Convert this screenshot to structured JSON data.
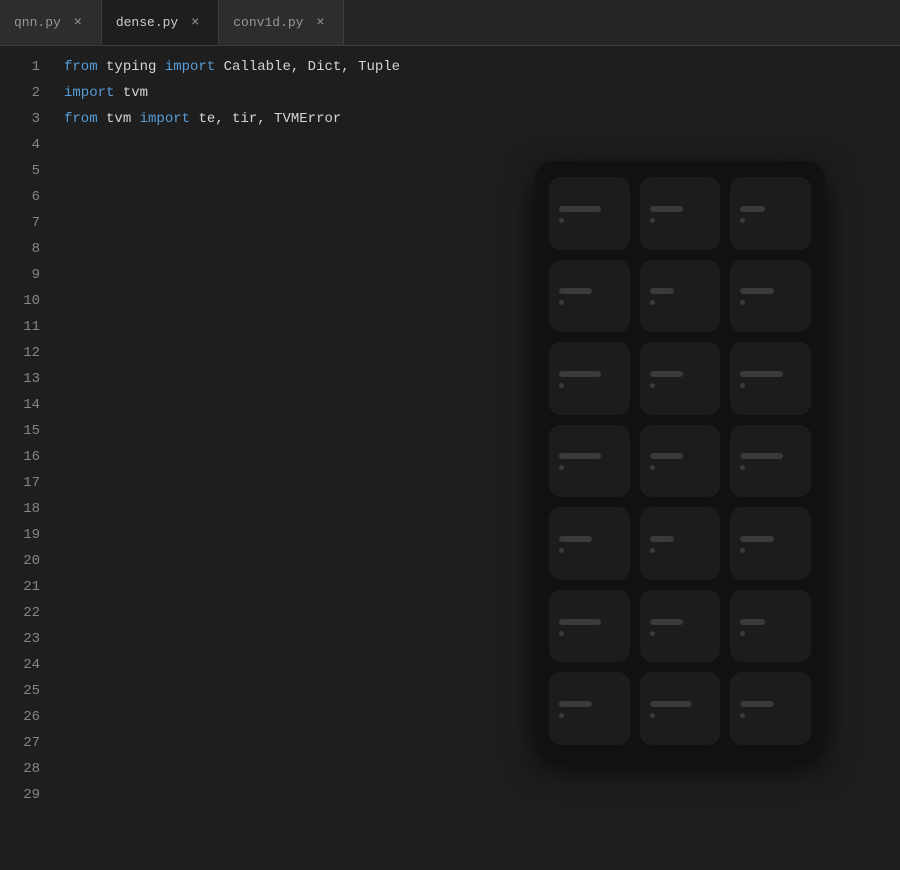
{
  "tabs": [
    {
      "id": "qnn",
      "name": "qnn.py",
      "active": false
    },
    {
      "id": "dense",
      "name": "dense.py",
      "active": true
    },
    {
      "id": "conv1d",
      "name": "conv1d.py",
      "active": false
    }
  ],
  "close_label": "×",
  "line_numbers": [
    1,
    2,
    3,
    4,
    5,
    6,
    7,
    8,
    9,
    10,
    11,
    12,
    13,
    14,
    15,
    16,
    17,
    18,
    19,
    20,
    21,
    22,
    23,
    24,
    25,
    26,
    27,
    28,
    29
  ],
  "code_lines": [
    {
      "n": 1,
      "segments": [
        {
          "t": "from",
          "c": "kw"
        },
        {
          "t": " typing ",
          "c": "plain"
        },
        {
          "t": "import",
          "c": "kw"
        },
        {
          "t": " Callable, Dict, Tuple",
          "c": "plain"
        }
      ]
    },
    {
      "n": 2,
      "segments": [
        {
          "t": "import",
          "c": "kw"
        },
        {
          "t": " tvm",
          "c": "plain"
        }
      ]
    },
    {
      "n": 3,
      "segments": [
        {
          "t": "from",
          "c": "kw"
        },
        {
          "t": " tvm ",
          "c": "plain"
        },
        {
          "t": "import",
          "c": "kw"
        },
        {
          "t": " te, tir, TVMError",
          "c": "plain"
        }
      ]
    }
  ],
  "overlay": {
    "rows": 7,
    "cols": 3
  }
}
